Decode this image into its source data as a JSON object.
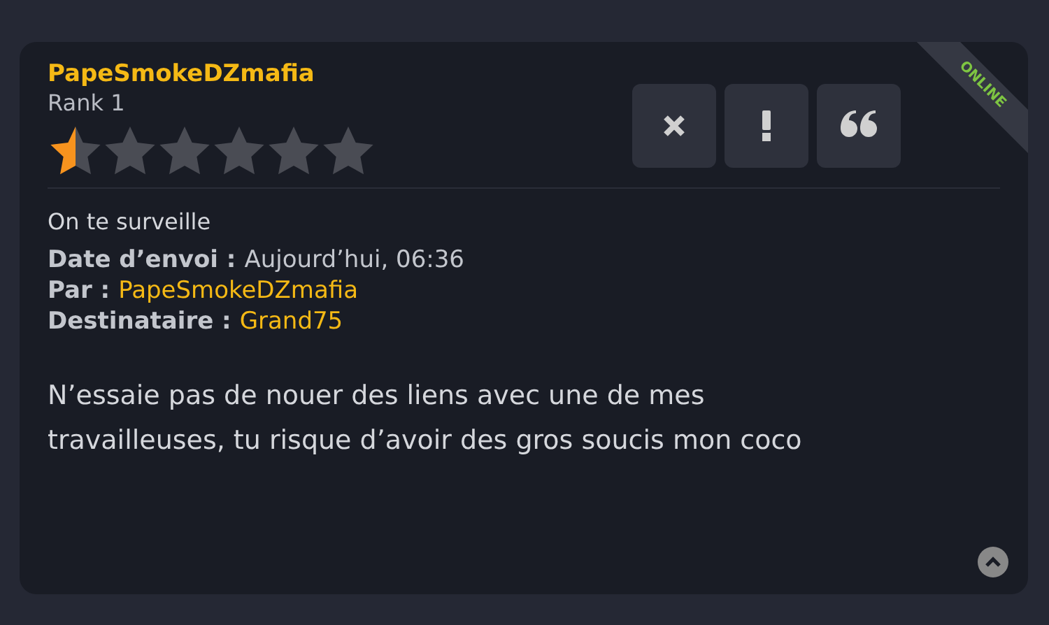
{
  "author": {
    "name": "PapeSmokeDZmafia",
    "rank": "Rank 1",
    "stars": 0.5,
    "status": "ONLINE"
  },
  "actions": [
    {
      "kind": "delete"
    },
    {
      "kind": "report"
    },
    {
      "kind": "quote"
    }
  ],
  "subject": "On te surveille",
  "meta": [
    {
      "label": "Date d’envoi :",
      "value": "Aujourd’hui, 06:36",
      "kind": "text"
    },
    {
      "label": "Par :",
      "value": "PapeSmokeDZmafia",
      "kind": "link"
    },
    {
      "label": "Destinataire :",
      "value": "Grand75",
      "kind": "link"
    }
  ],
  "message": "N’essaie pas de nouer des liens avec une de mes travailleuses, tu risque d’avoir des gros soucis mon coco"
}
